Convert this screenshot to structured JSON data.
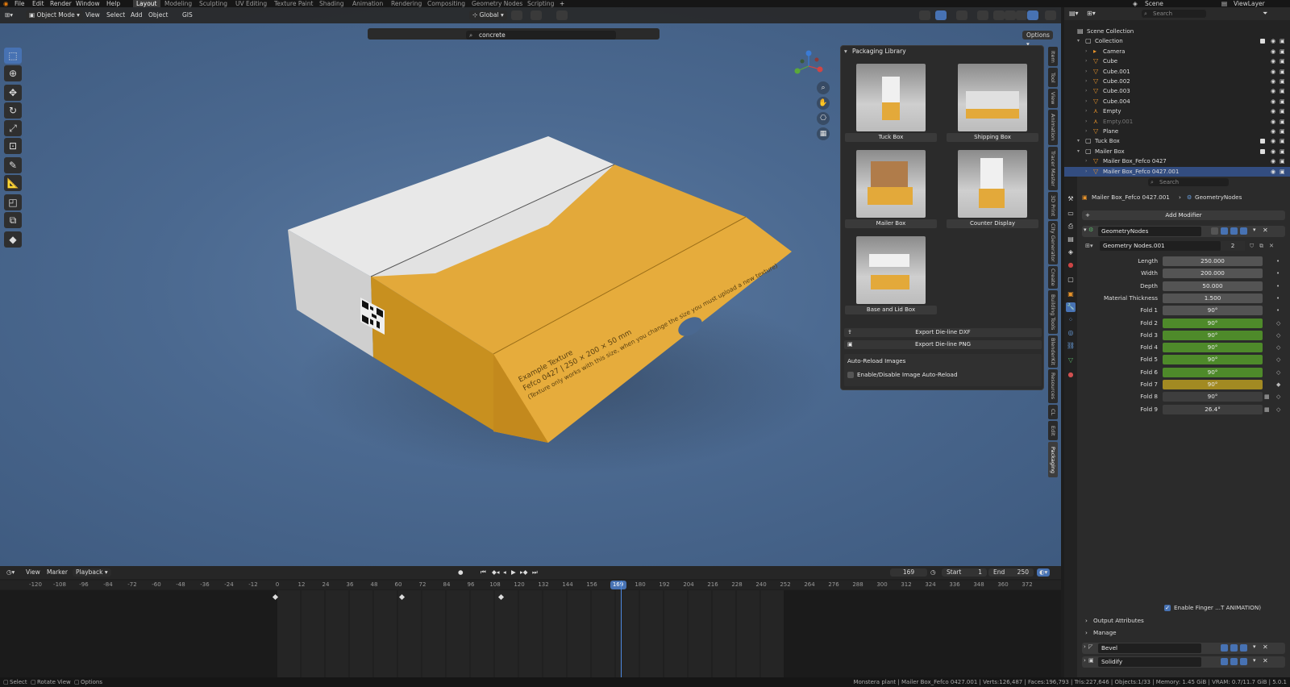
{
  "topbar": {
    "menus": [
      "File",
      "Edit",
      "Render",
      "Window",
      "Help"
    ],
    "workspaces": [
      "Layout",
      "Modeling",
      "Sculpting",
      "UV Editing",
      "Texture Paint",
      "Shading",
      "Animation",
      "Rendering",
      "Compositing",
      "Geometry Nodes",
      "Scripting"
    ],
    "active_workspace": "Layout",
    "add_tab": "+",
    "scene": "Scene",
    "view_layer": "ViewLayer"
  },
  "viewport_header": {
    "mode": "Object Mode",
    "menus": [
      "View",
      "Select",
      "Add",
      "Object",
      "GIS"
    ],
    "orientation": "Global",
    "search_value": "concrete",
    "options": "Options"
  },
  "side_tabs": [
    "Item",
    "Tool",
    "View",
    "Animation",
    "Tracer Master",
    "3D Print",
    "City Generator",
    "Create",
    "Building Tools",
    "BlenderKit",
    "Resources",
    "CL",
    "Edit",
    "Packaging"
  ],
  "active_side_tab": "Packaging",
  "packaging_library": {
    "title": "Packaging Library",
    "items": [
      "Tuck Box",
      "Shipping Box",
      "Mailer Box",
      "Counter Display",
      "Base and Lid Box"
    ],
    "export_dxf": "Export Die-line DXF",
    "export_png": "Export Die-line PNG",
    "auto_reload_title": "Auto-Reload Images",
    "auto_reload_toggle": "Enable/Disable Image Auto-Reload"
  },
  "box_texture": {
    "line1": "Example Texture",
    "line2": "Fefco 0427 | 250 × 200 × 50 mm",
    "line3": "(Texture only works with this size, when you change the size you must upload a new texture)"
  },
  "timeline": {
    "menus": [
      "View",
      "Marker",
      "Playback"
    ],
    "current_frame": "169",
    "start_label": "Start",
    "start": "1",
    "end_label": "End",
    "end": "250",
    "ticks": [
      "-120",
      "-108",
      "-96",
      "-84",
      "-72",
      "-60",
      "-48",
      "-36",
      "-24",
      "-12",
      "0",
      "12",
      "24",
      "36",
      "48",
      "60",
      "72",
      "84",
      "96",
      "108",
      "120",
      "132",
      "144",
      "156",
      "169",
      "180",
      "192",
      "204",
      "216",
      "228",
      "240",
      "252",
      "264",
      "276",
      "288",
      "300",
      "312",
      "324",
      "336",
      "348",
      "360",
      "372"
    ]
  },
  "outliner": {
    "search_placeholder": "Search",
    "rows": [
      {
        "name": "Scene Collection",
        "type": "scene",
        "indent": 0
      },
      {
        "name": "Collection",
        "type": "collection",
        "indent": 1
      },
      {
        "name": "Camera",
        "type": "camera",
        "indent": 2
      },
      {
        "name": "Cube",
        "type": "mesh",
        "indent": 2
      },
      {
        "name": "Cube.001",
        "type": "mesh",
        "indent": 2
      },
      {
        "name": "Cube.002",
        "type": "mesh",
        "indent": 2
      },
      {
        "name": "Cube.003",
        "type": "mesh",
        "indent": 2
      },
      {
        "name": "Cube.004",
        "type": "mesh",
        "indent": 2
      },
      {
        "name": "Empty",
        "type": "empty",
        "indent": 2
      },
      {
        "name": "Empty.001",
        "type": "empty",
        "indent": 2
      },
      {
        "name": "Plane",
        "type": "mesh",
        "indent": 2
      },
      {
        "name": "Tuck Box",
        "type": "collection",
        "indent": 1
      },
      {
        "name": "Mailer Box",
        "type": "collection",
        "indent": 1
      },
      {
        "name": "Mailer Box_Fefco 0427",
        "type": "mesh",
        "indent": 2
      },
      {
        "name": "Mailer Box_Fefco 0427.001",
        "type": "mesh",
        "indent": 2,
        "selected": true
      }
    ]
  },
  "properties": {
    "search_placeholder": "Search",
    "breadcrumb_object": "Mailer Box_Fefco 0427.001",
    "breadcrumb_modifier": "GeometryNodes",
    "add_modifier": "Add Modifier",
    "modifier_name": "GeometryNodes",
    "node_group": "Geometry Nodes.001",
    "node_users": "2",
    "inputs": [
      {
        "label": "Length",
        "value": "250.000",
        "style": "plain"
      },
      {
        "label": "Width",
        "value": "200.000",
        "style": "plain"
      },
      {
        "label": "Depth",
        "value": "50.000",
        "style": "plain"
      },
      {
        "label": "Material Thickness",
        "value": "1.500",
        "style": "plain"
      },
      {
        "label": "Fold 1",
        "value": "90°",
        "style": "plain"
      },
      {
        "label": "Fold 2",
        "value": "90°",
        "style": "green"
      },
      {
        "label": "Fold 3",
        "value": "90°",
        "style": "green"
      },
      {
        "label": "Fold 4",
        "value": "90°",
        "style": "green"
      },
      {
        "label": "Fold 5",
        "value": "90°",
        "style": "green"
      },
      {
        "label": "Fold 6",
        "value": "90°",
        "style": "green"
      },
      {
        "label": "Fold 7",
        "value": "90°",
        "style": "yellow"
      },
      {
        "label": "Fold 8",
        "value": "90°",
        "style": "grey"
      },
      {
        "label": "Fold 9",
        "value": "26.4°",
        "style": "grey"
      }
    ],
    "finger_toggle": "Enable Finger ...T ANIMATION)",
    "output_attributes": "Output Attributes",
    "manage": "Manage",
    "modifiers": [
      "Bevel",
      "Solidify"
    ]
  },
  "statusbar": {
    "select": "Select",
    "rotate": "Rotate View",
    "options": "Options",
    "stats": "Monstera plant | Mailer Box_Fefco 0427.001 | Verts:126,487 | Faces:196,793 | Tris:227,646 | Objects:1/33 | Memory: 1.45 GiB | VRAM: 0.7/11.7 GiB | 5.0.1"
  },
  "colors": {
    "accent": "#4772b3",
    "keyed": "#4e8a2a",
    "changed": "#a28a22",
    "box_yellow": "#e3a93a",
    "box_white": "#e6e6e6",
    "viewport_bg": "#4b6990"
  }
}
